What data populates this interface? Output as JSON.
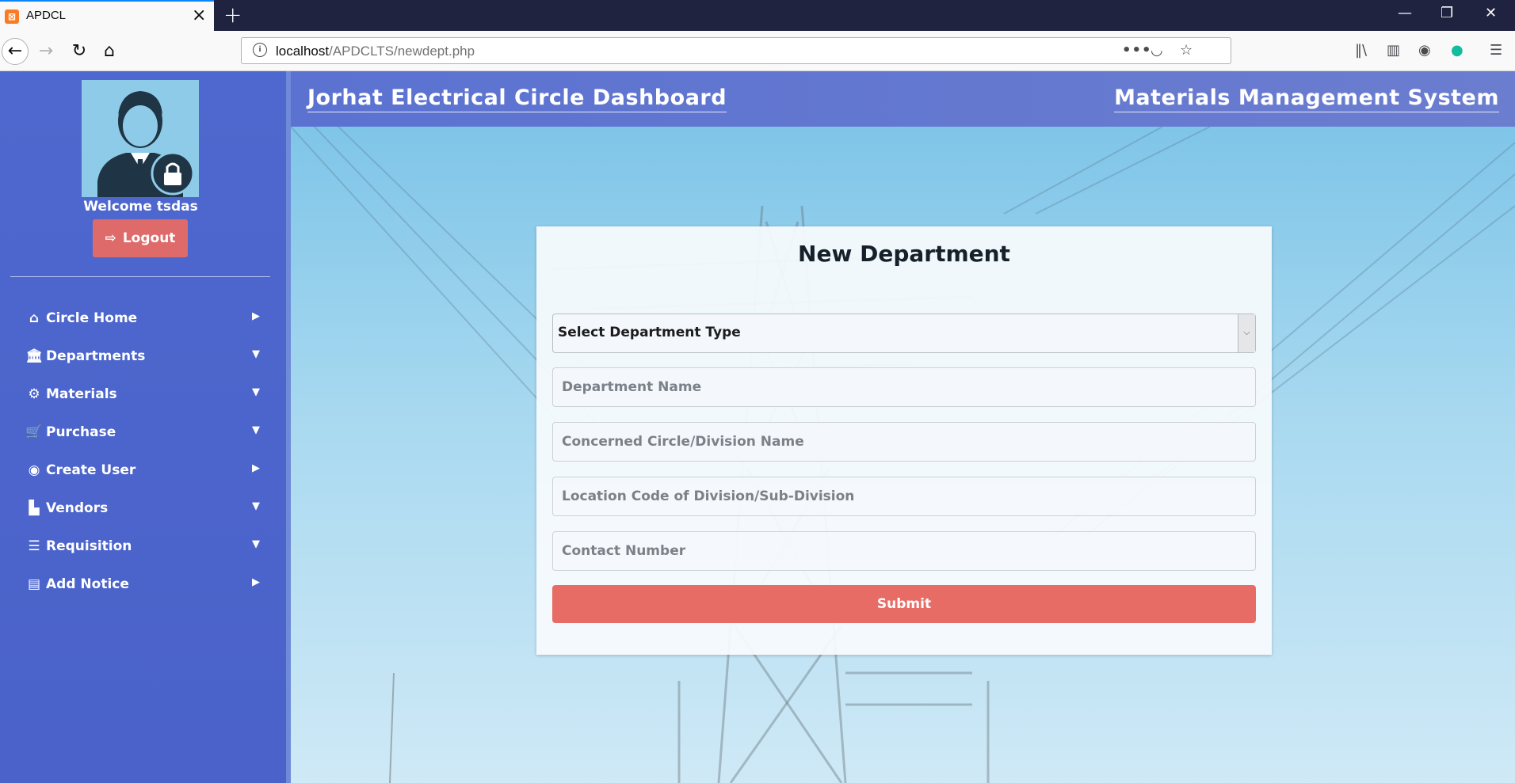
{
  "browser": {
    "tab_title": "APDCL",
    "favicon_glyph": "⊠",
    "new_tab": "+",
    "url_host": "localhost",
    "url_path": "/APDCLTS/newdept.php",
    "url_more": "•••",
    "controls": {
      "minimize": "—",
      "restore": "❐",
      "close": "✕"
    }
  },
  "header": {
    "left_title": "Jorhat Electrical Circle Dashboard",
    "right_title": "Materials Management System"
  },
  "sidebar": {
    "welcome": "Welcome tsdas",
    "logout_label": "Logout",
    "items": [
      {
        "label": "Circle Home",
        "icon": "home-icon",
        "glyph": "⌂",
        "caret": "▶"
      },
      {
        "label": "Departments",
        "icon": "bank-icon",
        "glyph": "🏛",
        "caret": "▼"
      },
      {
        "label": "Materials",
        "icon": "gears-icon",
        "glyph": "⚙",
        "caret": "▼"
      },
      {
        "label": "Purchase",
        "icon": "cart-icon",
        "glyph": "🛒",
        "caret": "▼"
      },
      {
        "label": "Create User",
        "icon": "user-circle-icon",
        "glyph": "◉",
        "caret": "▶"
      },
      {
        "label": "Vendors",
        "icon": "industry-icon",
        "glyph": "▙",
        "caret": "▼"
      },
      {
        "label": "Requisition",
        "icon": "list-icon",
        "glyph": "☰",
        "caret": "▼"
      },
      {
        "label": "Add Notice",
        "icon": "newspaper-icon",
        "glyph": "▤",
        "caret": "▶"
      }
    ]
  },
  "form": {
    "title": "New Department",
    "select_label": "Select Department Type",
    "fields": [
      {
        "placeholder": "Department Name"
      },
      {
        "placeholder": "Concerned Circle/Division Name"
      },
      {
        "placeholder": "Location Code of Division/Sub-Division"
      },
      {
        "placeholder": "Contact Number"
      }
    ],
    "submit_label": "Submit"
  },
  "colors": {
    "sidebar": "#4e68cf",
    "header": "#5b72d1",
    "logout": "#de6a69",
    "submit": "#e86c66"
  }
}
